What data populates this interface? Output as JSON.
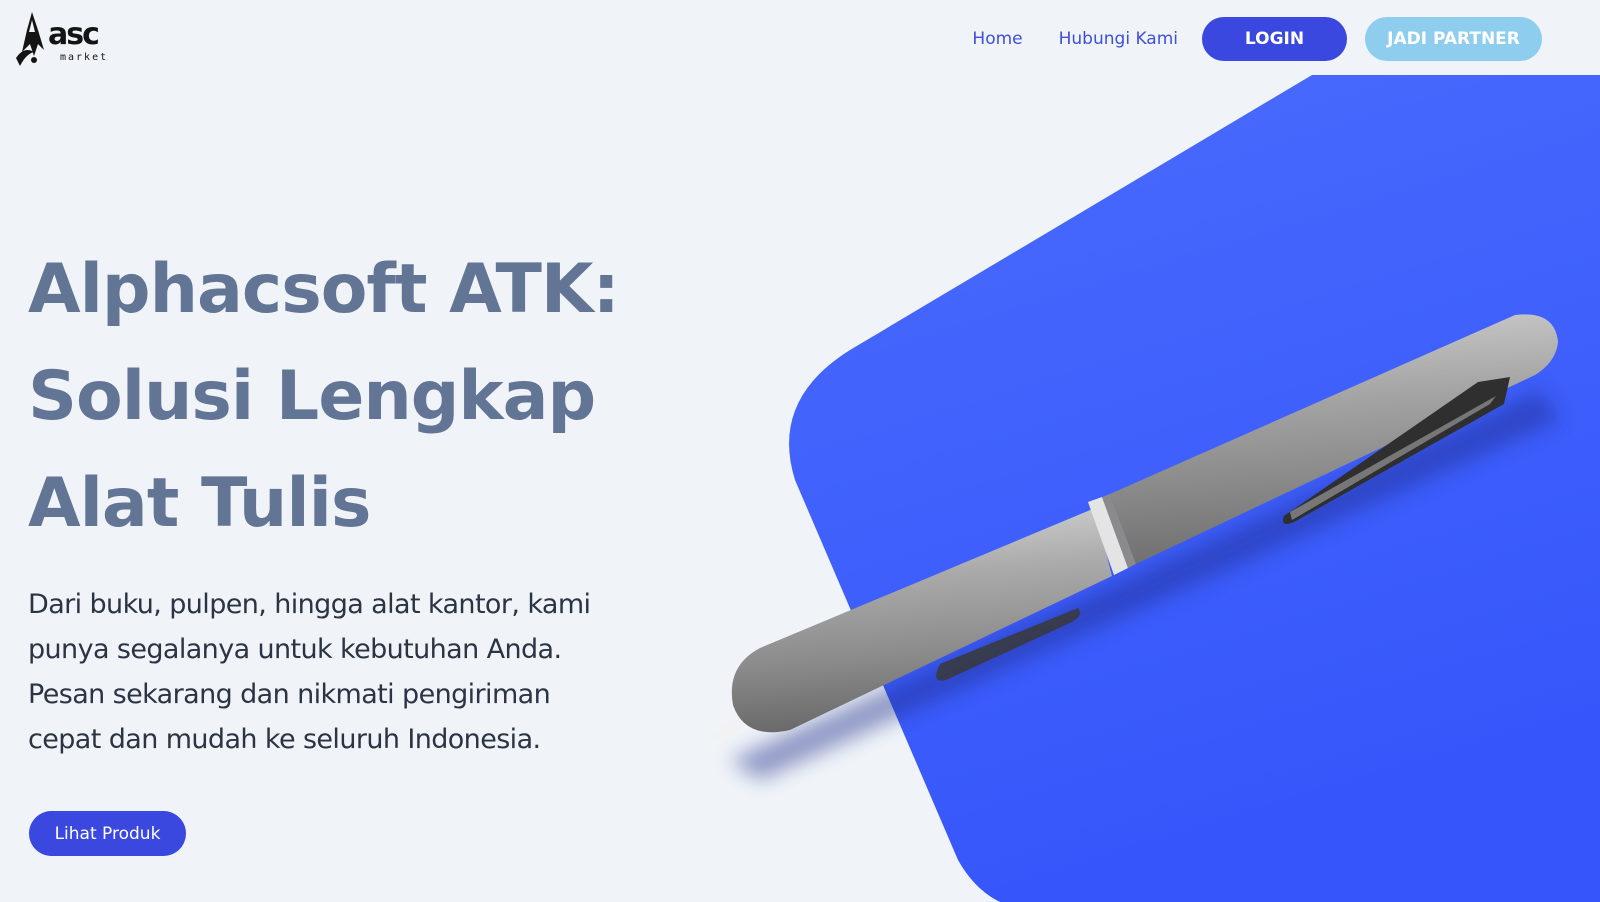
{
  "brand": {
    "name": "asc",
    "subtitle": "market",
    "logo_icon": "rocket-pen-icon"
  },
  "nav": {
    "links": [
      "Home",
      "Hubungi Kami"
    ],
    "login_label": "LOGIN",
    "partner_label": "JADI PARTNER"
  },
  "hero": {
    "title_lines": [
      "Alphacsoft ATK:",
      "Solusi Lengkap",
      "Alat Tulis"
    ],
    "description_lines": [
      "Dari buku, pulpen, hingga alat kantor, kami",
      "punya segalanya untuk kebutuhan Anda.",
      "Pesan sekarang dan nikmati pengiriman",
      "cepat dan mudah ke seluruh Indonesia."
    ],
    "cta_label": "Lihat Produk",
    "image": "silver-pen-illustration"
  },
  "colors": {
    "background": "#f0f4f9",
    "primary": "#3a48df",
    "secondary": "#8fcdef",
    "title": "#637595",
    "body_text": "#2c3444",
    "hero_shape": "#3d5bfc"
  }
}
